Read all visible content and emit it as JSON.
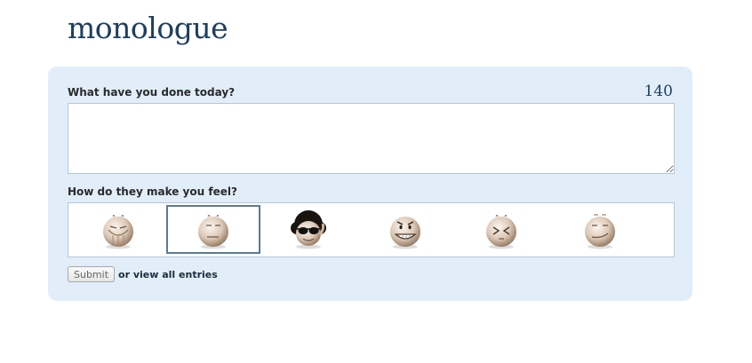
{
  "header": {
    "title": "monologue"
  },
  "form": {
    "question": "What have you done today?",
    "char_count": "140",
    "entry_value": "",
    "feel_label": "How do they make you feel?",
    "moods": [
      {
        "name": "squinting-face",
        "selected": false
      },
      {
        "name": "unimpressed-face",
        "selected": true
      },
      {
        "name": "cool-afro-face",
        "selected": false
      },
      {
        "name": "grinning-face",
        "selected": false
      },
      {
        "name": "dizzy-face",
        "selected": false
      },
      {
        "name": "smirking-face",
        "selected": false
      }
    ],
    "submit_label": "Submit",
    "view_link_text": "or view all entries"
  },
  "colors": {
    "title": "#1d3f60",
    "panel_bg": "#e1eefa",
    "border": "#b6c6d6",
    "selected_border": "#5b7a99"
  }
}
